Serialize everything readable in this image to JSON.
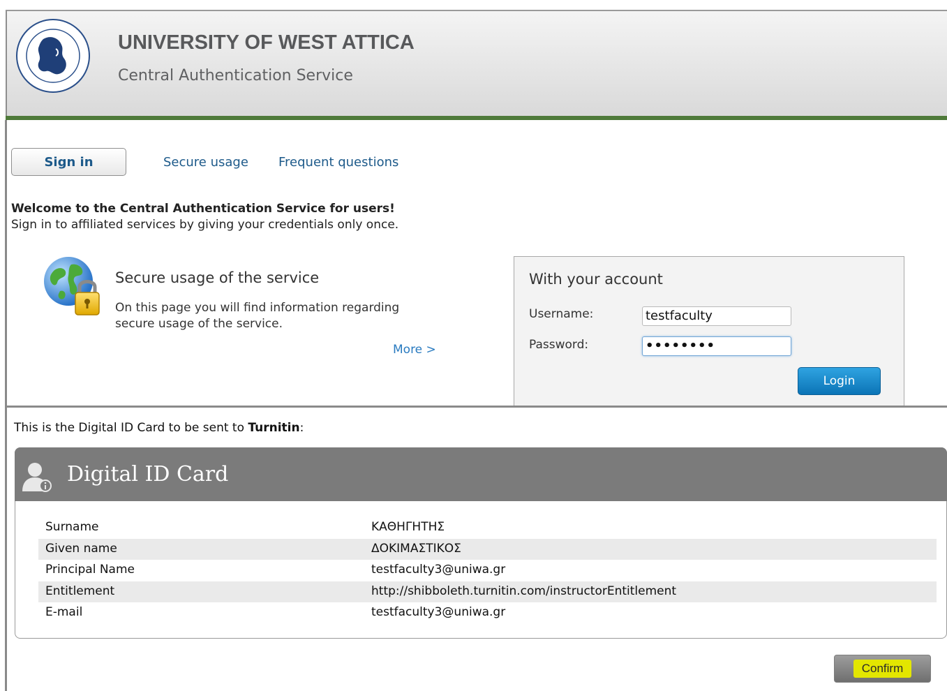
{
  "header": {
    "university": "UNIVERSITY OF WEST ATTICA",
    "service": "Central Authentication Service",
    "logo_icon": "university-seal-icon"
  },
  "tabs": [
    {
      "label": "Sign in",
      "active": true
    },
    {
      "label": "Secure usage",
      "active": false
    },
    {
      "label": "Frequent questions",
      "active": false
    }
  ],
  "welcome": {
    "line1": "Welcome to the Central Authentication Service for users!",
    "line2": "Sign in to affiliated services by giving your credentials only once."
  },
  "secure": {
    "icon": "globe-lock-icon",
    "title": "Secure usage of the service",
    "description": "On this page you will find information regarding secure usage of the service.",
    "more": "More >"
  },
  "login": {
    "heading": "With your account",
    "username_label": "Username:",
    "username_value": "testfaculty",
    "password_label": "Password:",
    "password_value": "••••••••",
    "button": "Login"
  },
  "consent": {
    "prefix": "This is the Digital ID Card to be sent to ",
    "service": "Turnitin",
    "suffix": ":"
  },
  "card": {
    "title": "Digital ID Card",
    "icon": "user-info-icon",
    "rows": [
      {
        "label": "Surname",
        "value": "ΚΑΘΗΓΗΤΗΣ"
      },
      {
        "label": "Given name",
        "value": "ΔΟΚΙΜΑΣΤΙΚΟΣ"
      },
      {
        "label": "Principal Name",
        "value": "testfaculty3@uniwa.gr"
      },
      {
        "label": "Entitlement",
        "value": "http://shibboleth.turnitin.com/instructorEntitlement"
      },
      {
        "label": "E-mail",
        "value": "testfaculty3@uniwa.gr"
      }
    ]
  },
  "confirm": {
    "label": "Confirm"
  },
  "colors": {
    "header_bar": "#4f7a3a",
    "link": "#1d5a8a",
    "login_button": "#1580c5",
    "card_header": "#7b7b7b",
    "confirm_highlight": "#e3e600"
  }
}
